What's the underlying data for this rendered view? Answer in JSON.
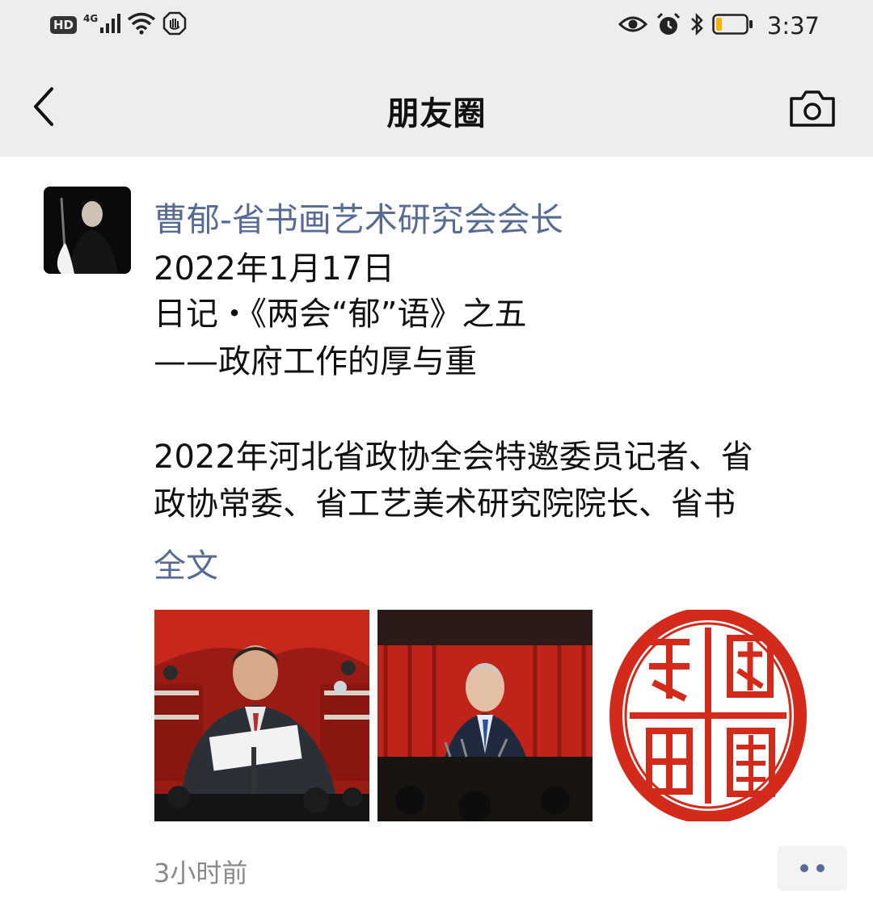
{
  "status_bar": {
    "hd_badge": "HD",
    "network": "4G",
    "time": "3:37",
    "icons": [
      "signal-icon",
      "wifi-icon",
      "shield-icon",
      "eye-icon",
      "alarm-icon",
      "bluetooth-icon",
      "battery-icon"
    ],
    "battery_level": 0.15,
    "battery_color": "#f5b400"
  },
  "nav": {
    "title": "朋友圈",
    "back_icon": "back-arrow-icon",
    "camera_icon": "camera-icon"
  },
  "post": {
    "author": "曹郁-省书画艺术研究会会长",
    "lines": [
      "2022年1月17日",
      "日记・《两会“郁”语》之五",
      "——政府工作的厚与重",
      "",
      "2022年河北省政协全会特邀委员记者、省",
      "政协常委、省工艺美术研究院院长、省书"
    ],
    "full_text_link": "全文",
    "timestamp": "3小时前",
    "seal_chars": [
      "兩",
      "會",
      "郁",
      "語"
    ]
  },
  "colors": {
    "link": "#576b95",
    "nav_bg": "#ededed",
    "seal_red": "#d42a1c"
  }
}
